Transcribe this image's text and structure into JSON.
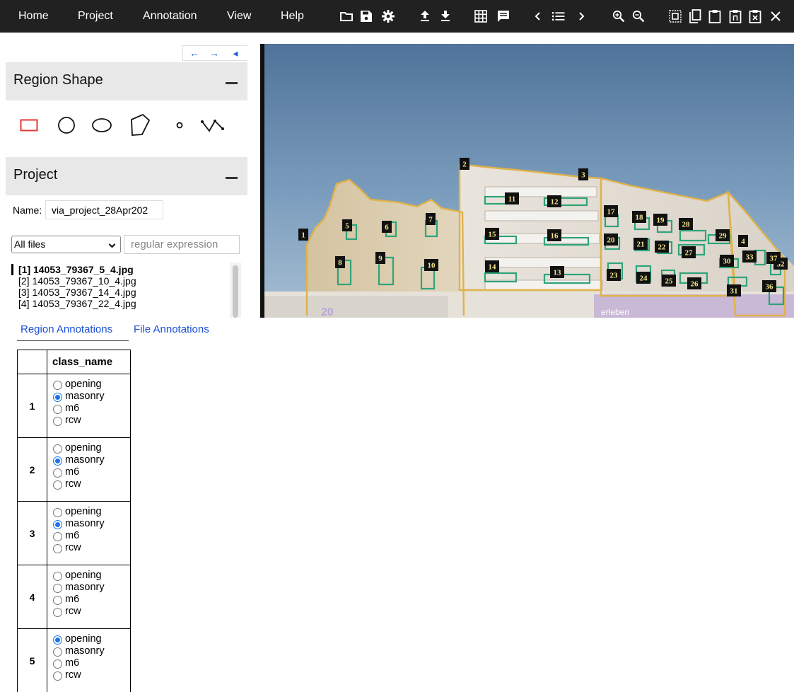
{
  "menu": [
    "Home",
    "Project",
    "Annotation",
    "View",
    "Help"
  ],
  "toolbar_icons": [
    "folder-icon",
    "save-icon",
    "settings-icon",
    "upload-icon",
    "download-icon",
    "grid-icon",
    "comment-icon",
    "chevron-left-icon",
    "list-icon",
    "chevron-right-icon",
    "zoom-in-icon",
    "zoom-out-icon",
    "select-all-icon",
    "copy-icon",
    "paste-icon",
    "paste-n-icon",
    "paste-delete-icon",
    "close-icon"
  ],
  "left_nav": {
    "prev": "←",
    "next": "→",
    "collapse": "◂"
  },
  "region_shape": {
    "title": "Region Shape",
    "shapes": [
      "rectangle",
      "circle",
      "ellipse",
      "polygon",
      "point",
      "polyline"
    ],
    "selected": "rectangle",
    "selected_color": "#e53935"
  },
  "project": {
    "title": "Project",
    "name_label": "Name:",
    "name_value": "via_project_28Apr202",
    "filter_selected": "All files",
    "regex_placeholder": "regular expression",
    "files": [
      "[1] 14053_79367_5_4.jpg",
      "[2] 14053_79367_10_4.jpg",
      "[3] 14053_79367_14_4.jpg",
      "[4] 14053_79367_22_4.jpg"
    ],
    "active_file_index": 0
  },
  "image": {
    "region_ids": [
      "1",
      "2",
      "3",
      "4",
      "5",
      "6",
      "7",
      "8",
      "9",
      "10",
      "11",
      "12",
      "13",
      "14",
      "15",
      "16",
      "17",
      "18",
      "19",
      "20",
      "21",
      "22",
      "23",
      "24",
      "25",
      "26",
      "27",
      "28",
      "29",
      "30",
      "31",
      "32",
      "33",
      "36",
      "37"
    ],
    "sign_text": "erleben",
    "sign_text_2": "20"
  },
  "tabs": {
    "region": "Region Annotations",
    "file": "File Annotations"
  },
  "table": {
    "header": "class_name",
    "options": [
      "opening",
      "masonry",
      "m6",
      "rcw"
    ],
    "rows": [
      {
        "id": "1",
        "selected": "masonry"
      },
      {
        "id": "2",
        "selected": "masonry"
      },
      {
        "id": "3",
        "selected": "masonry"
      },
      {
        "id": "4",
        "selected": ""
      },
      {
        "id": "5",
        "selected": "opening"
      }
    ]
  },
  "colors": {
    "topbar": "#212121",
    "link": "#1a4fd6",
    "region_outline": "#e0b24a",
    "window_outline": "#2fa37a"
  }
}
